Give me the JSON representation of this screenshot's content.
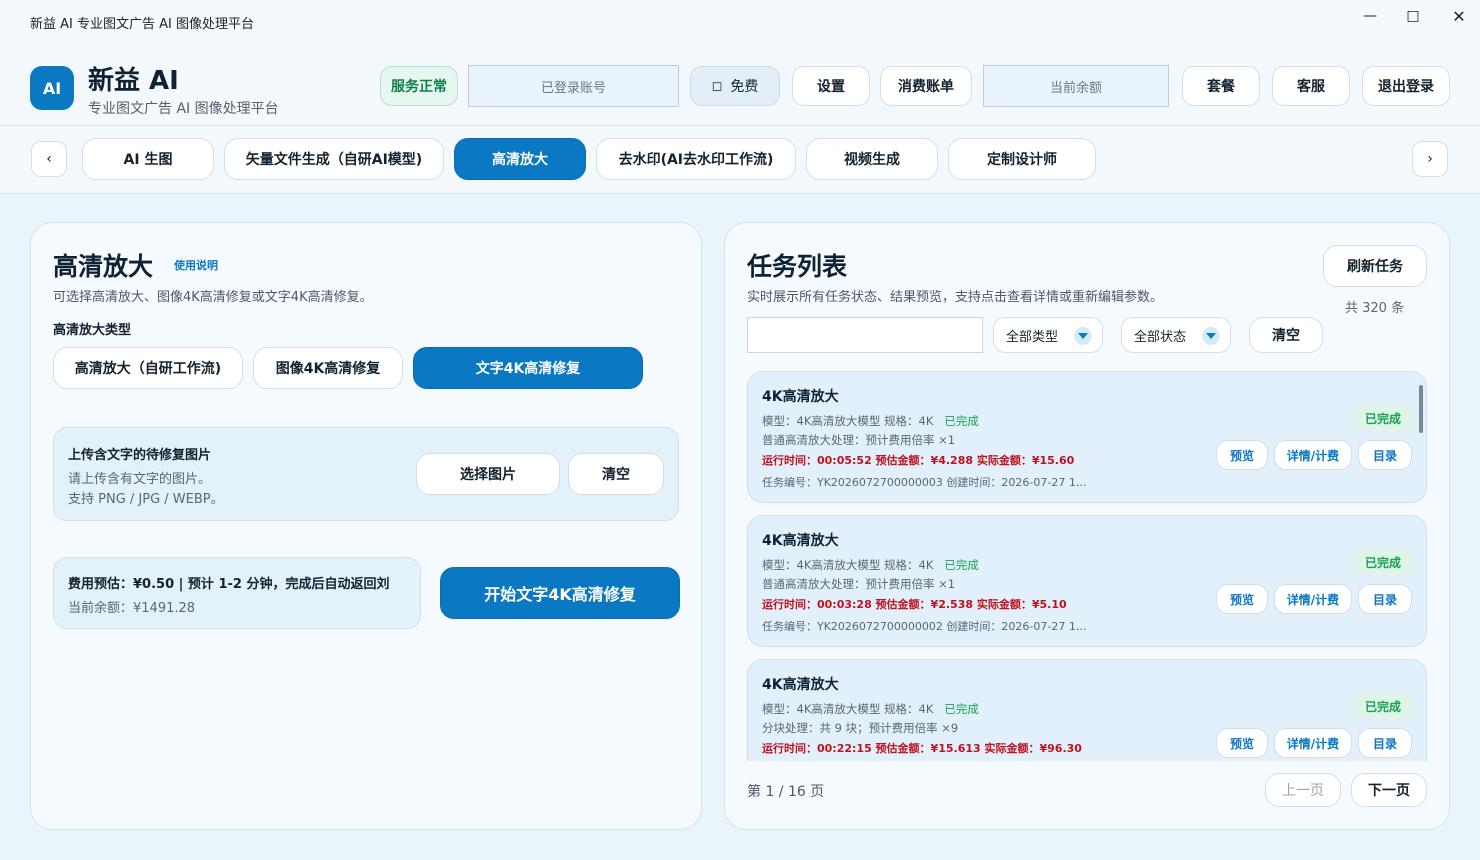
{
  "window": {
    "title": "新益 AI  专业图文广告 AI 图像处理平台"
  },
  "header": {
    "logo_text": "AI",
    "brand": "新益 AI",
    "subtitle": "专业图文广告 AI 图像处理平台",
    "status": "服务正常",
    "account_placeholder": "已登录账号",
    "plan_label": "免费",
    "settings": "设置",
    "billing": "消费账单",
    "balance_placeholder": "当前余额",
    "package": "套餐",
    "support": "客服",
    "logout": "退出登录"
  },
  "tabs": {
    "prev": "‹",
    "next": "›",
    "items": [
      {
        "label": "AI 生图"
      },
      {
        "label": "矢量文件生成（自研AI模型)"
      },
      {
        "label": "高清放大"
      },
      {
        "label": "去水印(AI去水印工作流)"
      },
      {
        "label": "视频生成"
      },
      {
        "label": "定制设计师"
      }
    ],
    "active_index": 2
  },
  "left": {
    "title": "高清放大",
    "help_link": "使用说明",
    "description": "可选择高清放大、图像4K高清修复或文字4K高清修复。",
    "type_label": "高清放大类型",
    "types": [
      {
        "label": "高清放大（自研工作流)"
      },
      {
        "label": "图像4K高清修复"
      },
      {
        "label": "文字4K高清修复"
      }
    ],
    "selected_type": 2,
    "upload": {
      "title": "上传含文字的待修复图片",
      "hint1": "请上传含有文字的图片。",
      "hint2": "支持 PNG / JPG / WEBP。",
      "select_button": "选择图片",
      "clear_button": "清空"
    },
    "cost": {
      "line1": "费用预估：¥0.50  |  预计 1-2 分钟，完成后自动返回刘",
      "line2": "当前余额：¥1491.28"
    },
    "start_button": "开始文字4K高清修复"
  },
  "right": {
    "title": "任务列表",
    "description": "实时展示所有任务状态、结果预览，支持点击查看详情或重新编辑参数。",
    "refresh_button": "刷新任务",
    "count": "共 320 条",
    "search_value": "",
    "type_filter": "全部类型",
    "status_filter": "全部状态",
    "clear_button": "清空",
    "tasks": [
      {
        "name": "4K高清放大",
        "meta": "模型：4K高清放大模型    规格：4K",
        "status": "已完成",
        "line2": "普通高清放大处理：预计费用倍率 ×1",
        "line3": "运行时间：00:05:52    预估金额：¥4.288    实际金额：¥15.60",
        "line4": "任务编号：YK2026072700000003      创建时间：2026-07-27 1...",
        "badge": "已完成",
        "preview": "预览",
        "detail": "详情/计费",
        "folder": "目录"
      },
      {
        "name": "4K高清放大",
        "meta": "模型：4K高清放大模型    规格：4K",
        "status": "已完成",
        "line2": "普通高清放大处理：预计费用倍率 ×1",
        "line3": "运行时间：00:03:28    预估金额：¥2.538    实际金额：¥5.10",
        "line4": "任务编号：YK2026072700000002      创建时间：2026-07-27 1...",
        "badge": "已完成",
        "preview": "预览",
        "detail": "详情/计费",
        "folder": "目录"
      },
      {
        "name": "4K高清放大",
        "meta": "模型：4K高清放大模型    规格：4K",
        "status": "已完成",
        "line2": "分块处理：共 9 块；预计费用倍率 ×9",
        "line3": "运行时间：00:22:15    预估金额：¥15.613    实际金额：¥96.30",
        "line4": "",
        "badge": "已完成",
        "preview": "预览",
        "detail": "详情/计费",
        "folder": "目录"
      }
    ],
    "pager": {
      "text": "第 1 / 16 页",
      "prev": "上一页",
      "next": "下一页"
    }
  },
  "colors": {
    "accent": "#0a78c2",
    "success": "#19a154",
    "danger": "#c0121e",
    "background": "#eaf4fb"
  }
}
